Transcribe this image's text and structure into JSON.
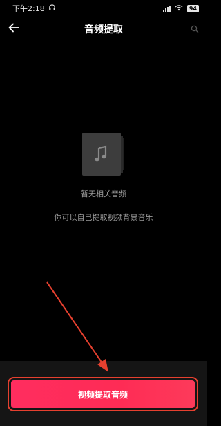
{
  "status_bar": {
    "time": "下午2:18",
    "battery": "94"
  },
  "header": {
    "title": "音频提取"
  },
  "empty_state": {
    "title": "暂无相关音频",
    "description": "你可以自己提取视频背景音乐"
  },
  "primary_action": {
    "label": "视频提取音频"
  },
  "colors": {
    "background": "#000000",
    "accent": "#fe2c55",
    "annotation": "#e6402f"
  },
  "icons": {
    "back": "arrow-left-icon",
    "search": "search-icon",
    "empty": "music-note-icon",
    "headphones": "headphones-icon",
    "signal": "signal-icon",
    "wifi": "wifi-icon"
  }
}
